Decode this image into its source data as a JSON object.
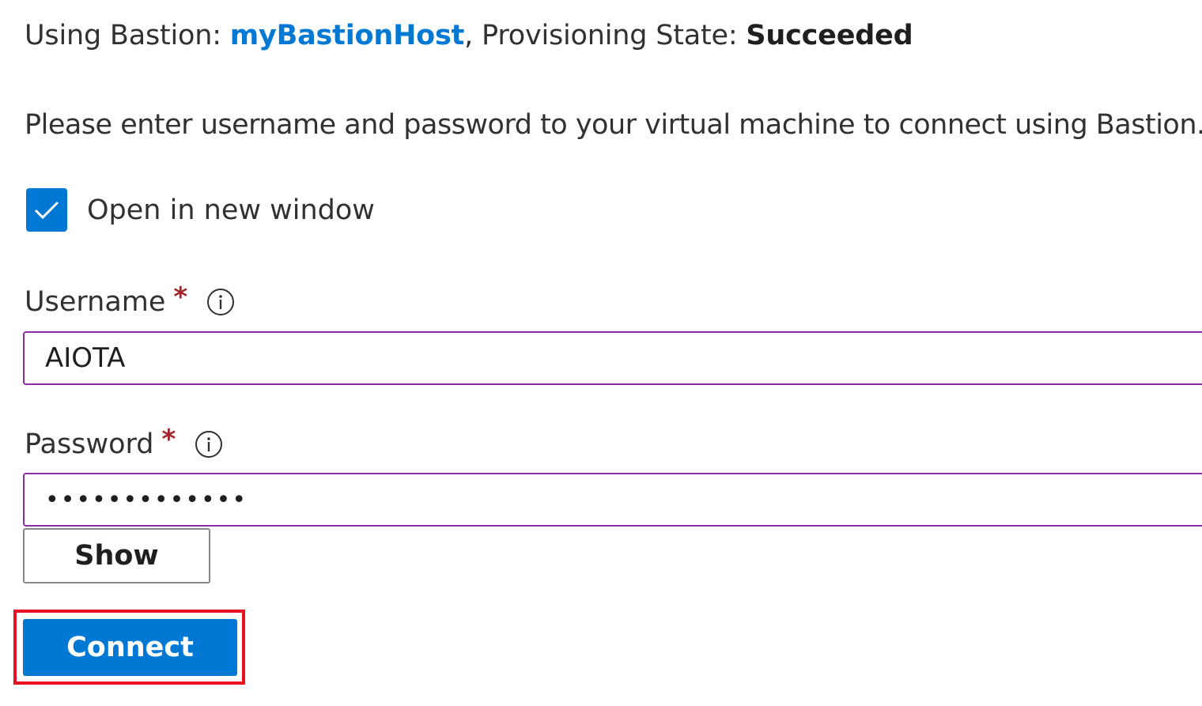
{
  "status": {
    "prefix": "Using Bastion: ",
    "bastion_name": "myBastionHost",
    "middle": ", Provisioning State: ",
    "state": "Succeeded"
  },
  "instruction": "Please enter username and password to your virtual machine to connect using Bastion.",
  "open_new_window": {
    "label": "Open in new window",
    "checked": true
  },
  "username": {
    "label": "Username",
    "required_mark": "*",
    "value": "AIOTA"
  },
  "password": {
    "label": "Password",
    "required_mark": "*",
    "masked_value": "•••••••••••••"
  },
  "buttons": {
    "show_label": "Show",
    "connect_label": "Connect"
  },
  "icons": {
    "checkbox": "checkmark-icon",
    "info": "info-icon"
  },
  "colors": {
    "accent": "#0078d4",
    "required": "#a4262c",
    "input_border": "#8a2da5",
    "highlight": "#e81123"
  }
}
